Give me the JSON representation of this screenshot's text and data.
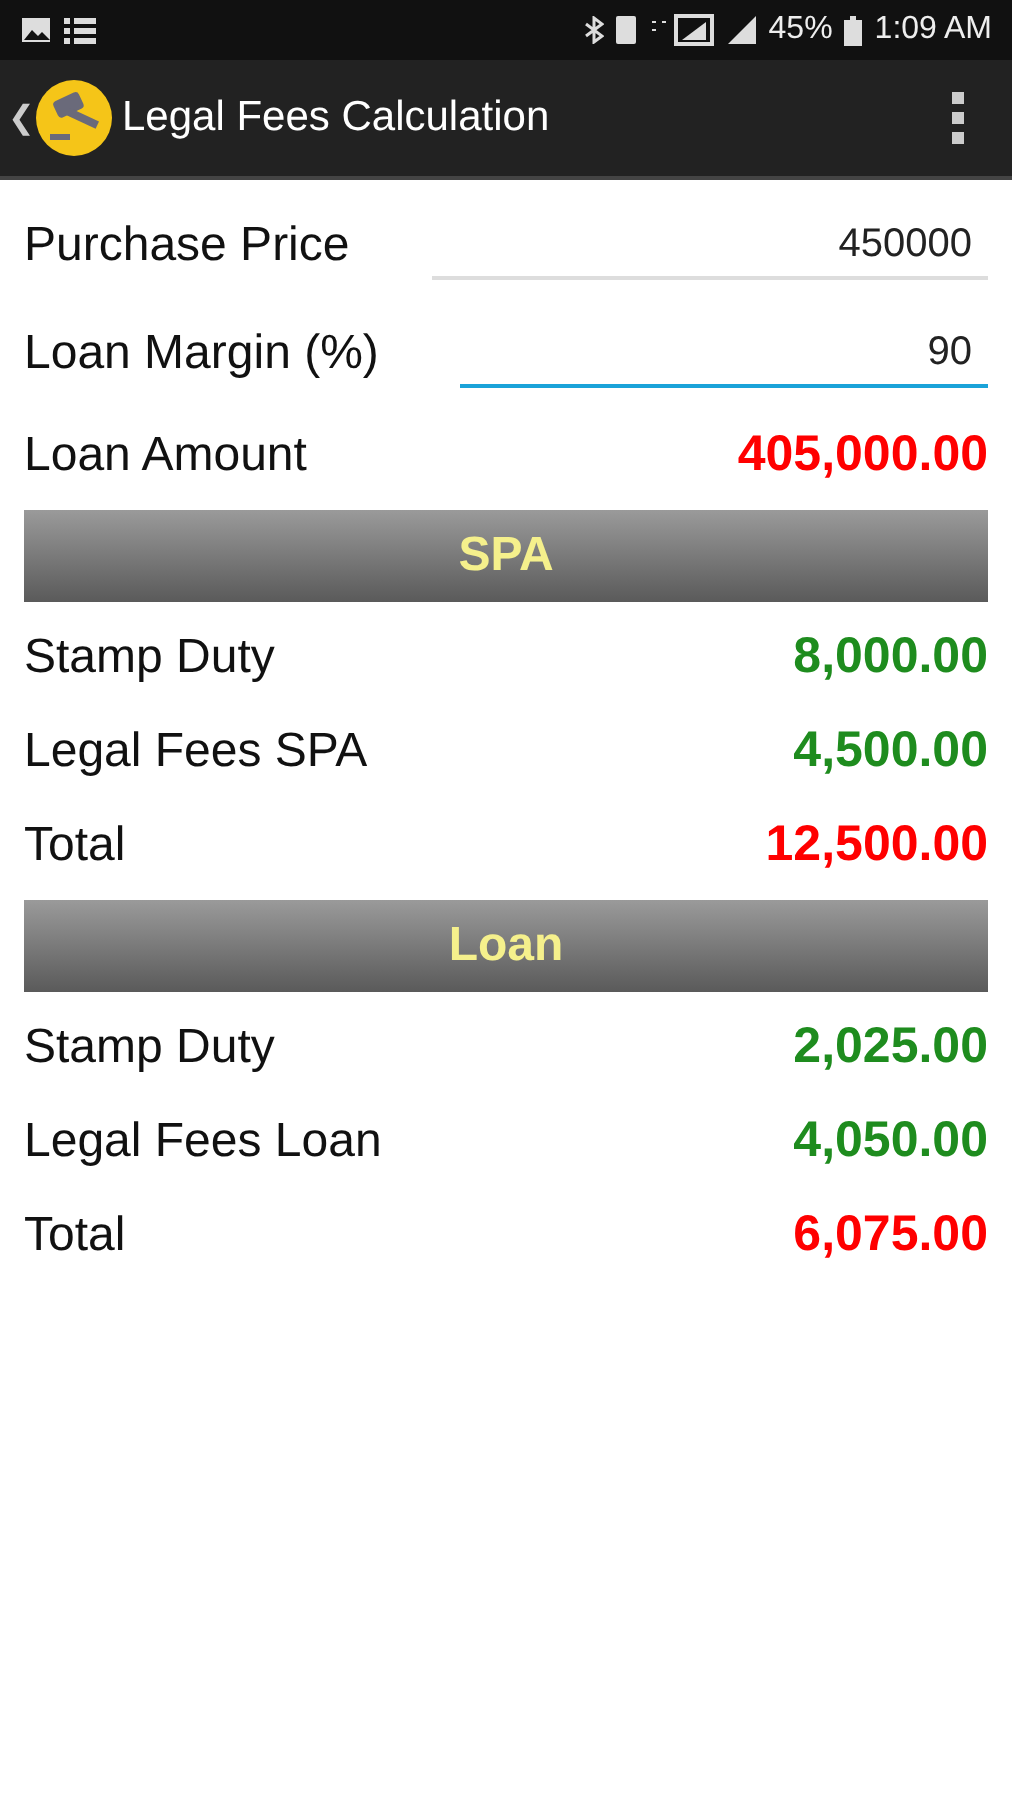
{
  "status_bar": {
    "battery": "45%",
    "time": "1:09 AM"
  },
  "toolbar": {
    "title": "Legal Fees Calculation",
    "back": "❮"
  },
  "inputs": [
    {
      "label": "Purchase Price",
      "value": "450000",
      "focused": false
    },
    {
      "label": "Loan Margin (%)",
      "value": "90",
      "focused": true
    }
  ],
  "loan_amount": {
    "label": "Loan Amount",
    "value": "405,000.00",
    "color": "#ff0000"
  },
  "sections": [
    {
      "title": "SPA",
      "rows": [
        {
          "label": "Stamp Duty",
          "value": "8,000.00",
          "color": "#1e8c1e"
        },
        {
          "label": "Legal Fees SPA",
          "value": "4,500.00",
          "color": "#1e8c1e"
        },
        {
          "label": "Total",
          "value": "12,500.00",
          "color": "#ff0000"
        }
      ]
    },
    {
      "title": "Loan",
      "rows": [
        {
          "label": "Stamp Duty",
          "value": "2,025.00",
          "color": "#1e8c1e"
        },
        {
          "label": "Legal Fees Loan",
          "value": "4,050.00",
          "color": "#1e8c1e"
        },
        {
          "label": "Total",
          "value": "6,075.00",
          "color": "#ff0000"
        }
      ]
    }
  ]
}
